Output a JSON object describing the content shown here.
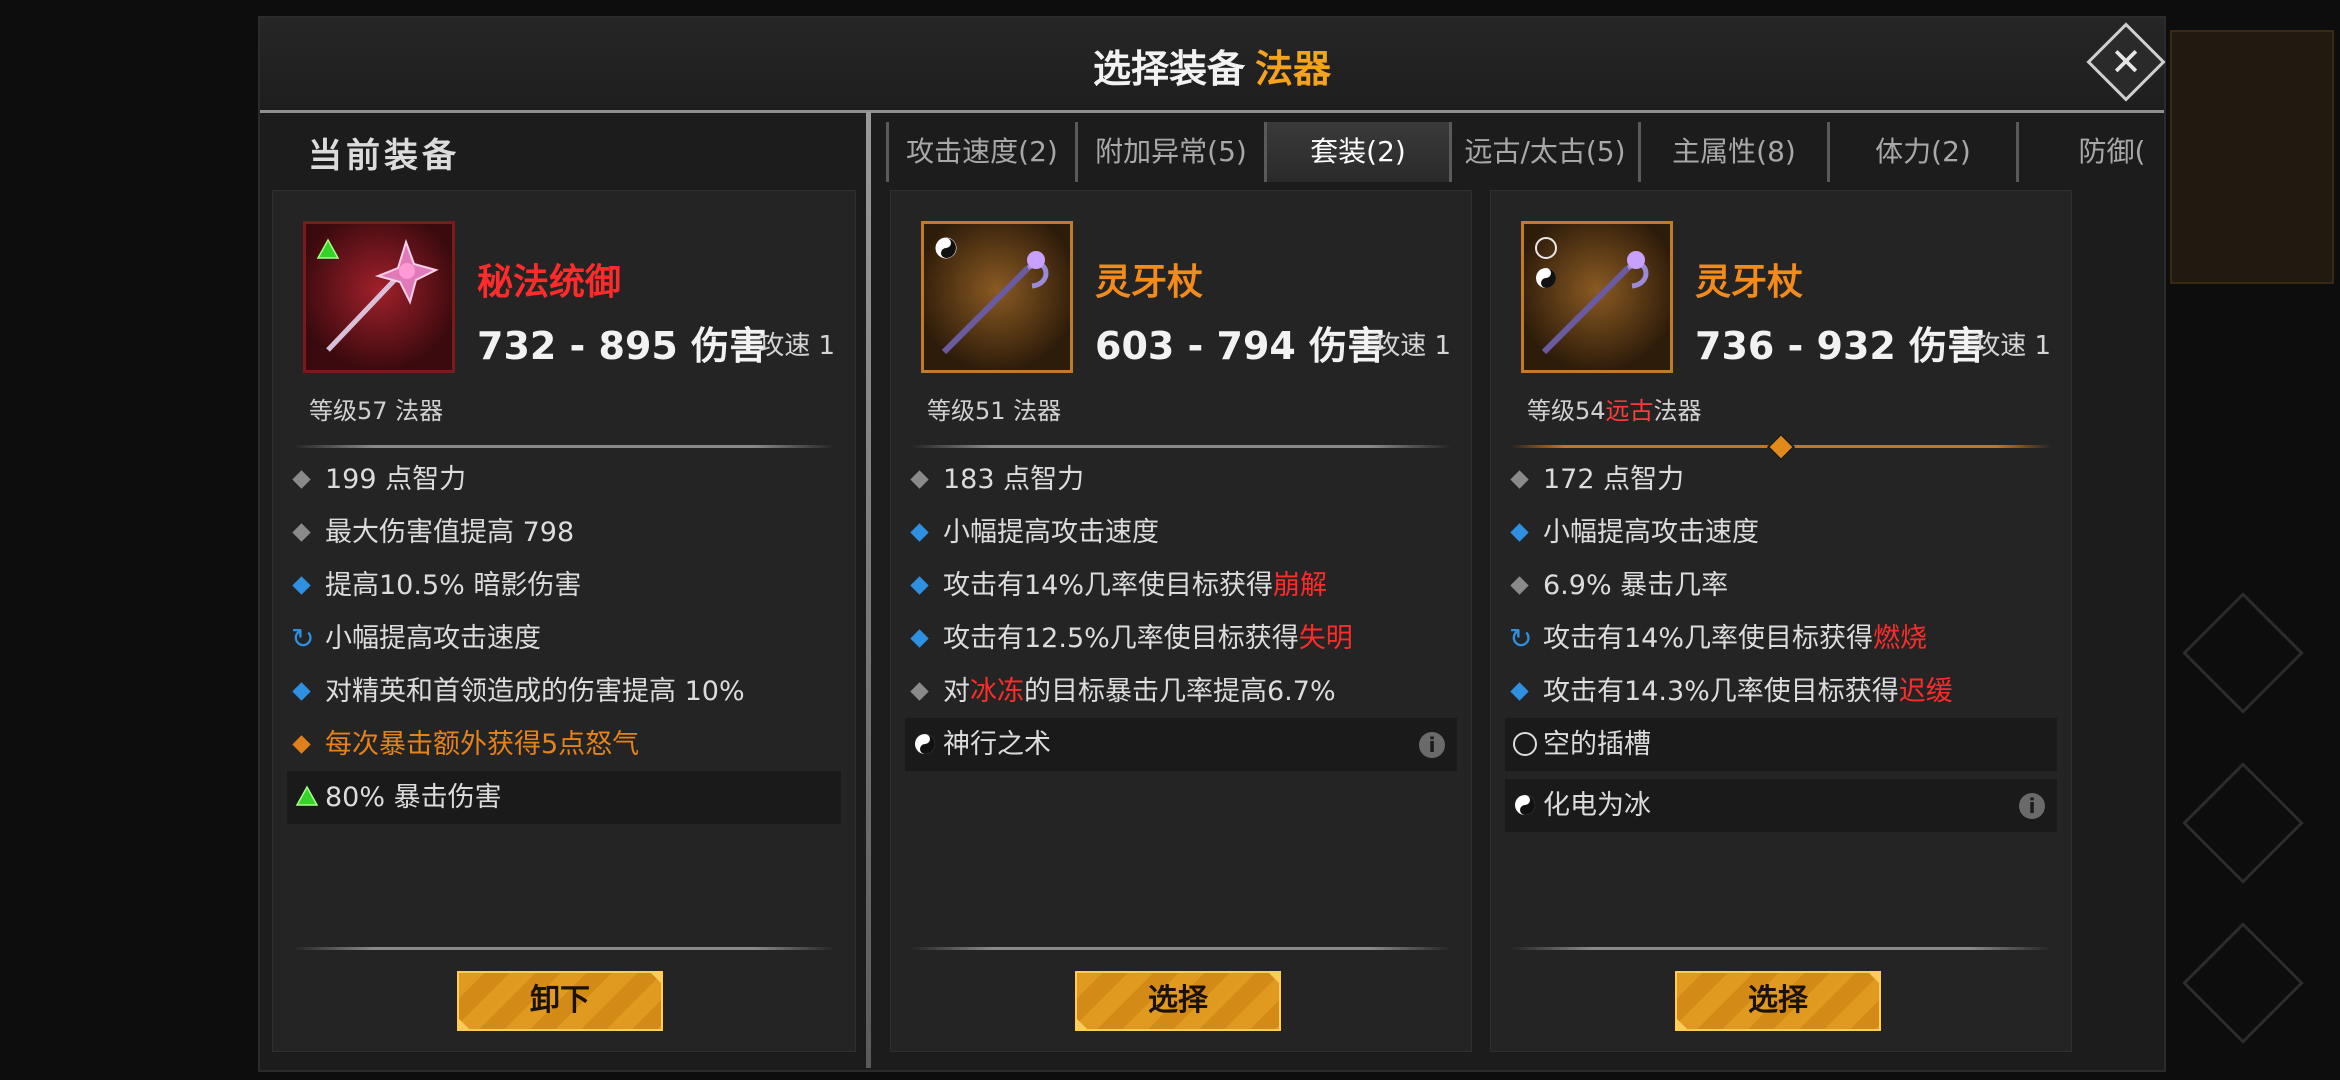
{
  "title": {
    "main": "选择装备",
    "category": "法器"
  },
  "close_icon_glyph": "✕",
  "current": {
    "section_title": "当前装备",
    "name": "秘法统御",
    "damage": "732 - 895 伤害",
    "speed": "攻速 1",
    "level": "等级57 法器",
    "stats": [
      {
        "bullet": "grey",
        "text": "199 点智力"
      },
      {
        "bullet": "grey",
        "text": "最大伤害值提高 798"
      },
      {
        "bullet": "blue",
        "text": "提高10.5% 暗影伤害"
      },
      {
        "bullet": "cycle",
        "text": "小幅提高攻击速度"
      },
      {
        "bullet": "blue",
        "text": "对精英和首领造成的伤害提高 10%"
      },
      {
        "bullet": "orange",
        "text": "每次暴击额外获得5点怒气"
      }
    ],
    "gem_stat": "80% 暴击伤害",
    "button": "卸下"
  },
  "tabs": [
    {
      "label": "攻击速度(2)",
      "active": false
    },
    {
      "label": "附加异常(5)",
      "active": false
    },
    {
      "label": "套装(2)",
      "active": true
    },
    {
      "label": "远古/太古(5)",
      "active": false
    },
    {
      "label": "主属性(8)",
      "active": false
    },
    {
      "label": "体力(2)",
      "active": false
    },
    {
      "label": "防御(",
      "active": false
    }
  ],
  "candidate1": {
    "name": "灵牙杖",
    "damage": "603 - 794 伤害",
    "speed": "攻速 1",
    "level": "等级51 法器",
    "stats": {
      "s1": "183 点智力",
      "s2": "小幅提高攻击速度",
      "s3_pre": "攻击有14%几率使目标获得",
      "s3_red": "崩解",
      "s4_pre": "攻击有12.5%几率使目标获得",
      "s4_red": "失明",
      "s5_pre": "对",
      "s5_red": "冰冻",
      "s5_post": "的目标暴击几率提高6.7%"
    },
    "set_stat": "神行之术",
    "button": "选择"
  },
  "candidate2": {
    "name": "灵牙杖",
    "damage": "736 - 932 伤害",
    "speed": "攻速 1",
    "level_pre": "等级54",
    "level_red": "远古",
    "level_post": "法器",
    "stats": {
      "s1": "172 点智力",
      "s2": "小幅提高攻击速度",
      "s3": "6.9% 暴击几率",
      "s4_pre": "攻击有14%几率使目标获得",
      "s4_red": "燃烧",
      "s5_pre": "攻击有14.3%几率使目标获得",
      "s5_red": "迟缓"
    },
    "empty_socket": "空的插槽",
    "set_stat": "化电为冰",
    "button": "选择"
  },
  "info_glyph": "i",
  "colors": {
    "accent": "#f5a21e",
    "red": "#ff2b2b",
    "blue": "#2f8fe0"
  }
}
